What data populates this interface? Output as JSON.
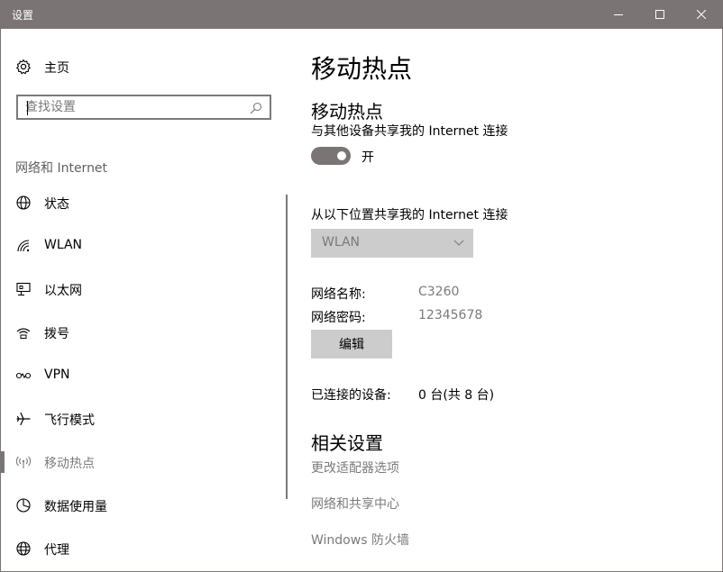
{
  "window": {
    "title": "设置",
    "controls": {
      "minimize": "minimize-icon",
      "maximize": "maximize-icon",
      "close": "close-icon"
    }
  },
  "sidebar": {
    "home_label": "主页",
    "search_placeholder": "查找设置",
    "section_header": "网络和 Internet",
    "items": [
      {
        "label": "状态",
        "icon": "globe-icon",
        "active": false
      },
      {
        "label": "WLAN",
        "icon": "wifi-icon",
        "active": false
      },
      {
        "label": "以太网",
        "icon": "ethernet-icon",
        "active": false
      },
      {
        "label": "拨号",
        "icon": "dialup-icon",
        "active": false
      },
      {
        "label": "VPN",
        "icon": "vpn-icon",
        "active": false
      },
      {
        "label": "飞行模式",
        "icon": "airplane-icon",
        "active": false
      },
      {
        "label": "移动热点",
        "icon": "hotspot-icon",
        "active": true
      },
      {
        "label": "数据使用量",
        "icon": "data-usage-icon",
        "active": false
      },
      {
        "label": "代理",
        "icon": "proxy-icon",
        "active": false
      }
    ]
  },
  "main": {
    "page_title": "移动热点",
    "hotspot": {
      "title": "移动热点",
      "description": "与其他设备共享我的 Internet 连接",
      "toggle_on": true,
      "toggle_label": "开"
    },
    "share_from": {
      "label": "从以下位置共享我的 Internet 连接",
      "selected": "WLAN"
    },
    "network_name_label": "网络名称:",
    "network_name_value": "C3260",
    "network_password_label": "网络密码:",
    "network_password_value": "12345678",
    "edit_button": "编辑",
    "connected_label": "已连接的设备:",
    "connected_value": "0 台(共 8 台)",
    "related": {
      "title": "相关设置",
      "links": [
        "更改适配器选项",
        "网络和共享中心",
        "Windows 防火墙"
      ]
    }
  },
  "colors": {
    "titlebar": "#7a7574",
    "toggle_on": "#7a7574",
    "disabled": "#cccccc",
    "muted_text": "#7a7a7a"
  }
}
